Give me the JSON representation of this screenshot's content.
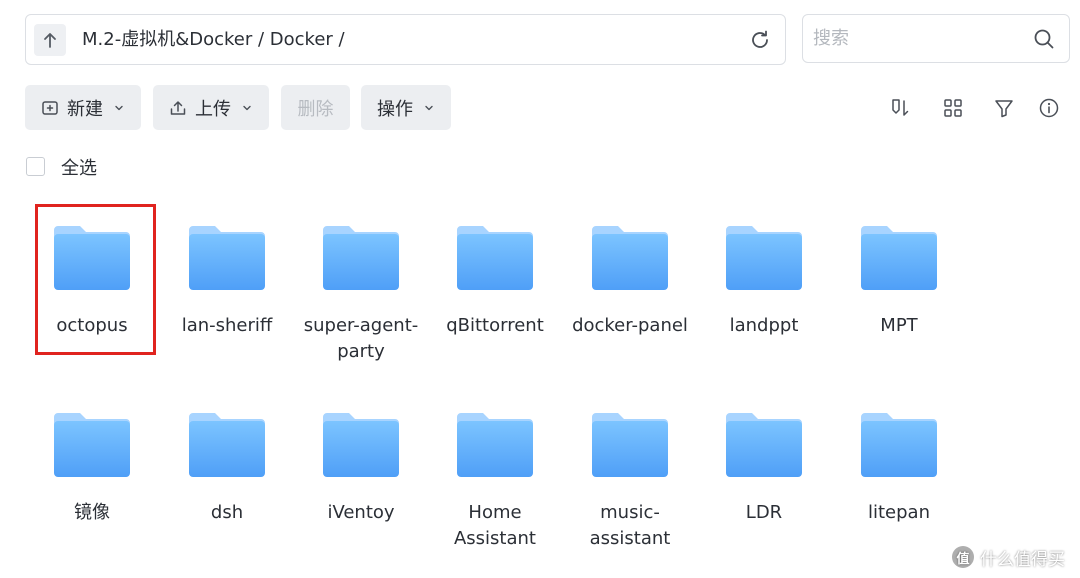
{
  "address_bar": {
    "path": "M.2-虚拟机&Docker / Docker /"
  },
  "search": {
    "placeholder": "搜索"
  },
  "toolbar": {
    "new_label": "新建",
    "upload_label": "上传",
    "delete_label": "删除",
    "actions_label": "操作"
  },
  "select_all": {
    "label": "全选"
  },
  "folders": [
    {
      "lines": [
        "octopus"
      ]
    },
    {
      "lines": [
        "lan-sheriff"
      ]
    },
    {
      "lines": [
        "super-agent-",
        "party"
      ]
    },
    {
      "lines": [
        "qBittorrent"
      ]
    },
    {
      "lines": [
        "docker-panel"
      ]
    },
    {
      "lines": [
        "landppt"
      ]
    },
    {
      "lines": [
        "MPT"
      ]
    },
    {
      "lines": [
        "镜像"
      ]
    },
    {
      "lines": [
        "dsh"
      ]
    },
    {
      "lines": [
        "iVentoy"
      ]
    },
    {
      "lines": [
        "Home",
        "Assistant"
      ]
    },
    {
      "lines": [
        "music-",
        "assistant"
      ]
    },
    {
      "lines": [
        "LDR"
      ]
    },
    {
      "lines": [
        "litepan"
      ]
    }
  ],
  "watermark": {
    "text": "什么值得买",
    "badge": "值"
  },
  "colors": {
    "folder_front_top": "#7cc4ff",
    "folder_front_bottom": "#4f9ff7",
    "folder_back": "#a8d4ff",
    "highlight_border": "#e0231f"
  }
}
